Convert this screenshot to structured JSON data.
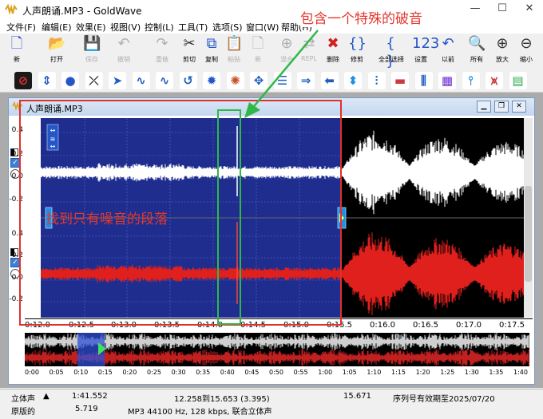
{
  "window": {
    "title": "人声朗诵.MP3 - GoldWave"
  },
  "menu": [
    "文件(F)",
    "编辑(E)",
    "效果(E)",
    "视图(V)",
    "控制(L)",
    "工具(T)",
    "选项(S)",
    "窗口(W)",
    "帮助(H)"
  ],
  "toolbar1": [
    {
      "label": "新",
      "icon": "new-file-icon",
      "glyph": "🗋",
      "disabled": false
    },
    {
      "label": "打开",
      "icon": "open-folder-icon",
      "glyph": "📂",
      "disabled": false
    },
    {
      "label": "保存",
      "icon": "save-icon",
      "glyph": "💾",
      "disabled": true
    },
    {
      "label": "撤销",
      "icon": "undo-icon",
      "glyph": "↶",
      "disabled": true
    },
    {
      "label": "重做",
      "icon": "redo-icon",
      "glyph": "↷",
      "disabled": true
    },
    {
      "label": "剪切",
      "icon": "cut-icon",
      "glyph": "✂",
      "disabled": false
    },
    {
      "label": "复制",
      "icon": "copy-icon",
      "glyph": "⧉",
      "disabled": false
    },
    {
      "label": "粘贴",
      "icon": "paste-icon",
      "glyph": "📋",
      "disabled": true
    },
    {
      "label": "新",
      "icon": "paste-new-icon",
      "glyph": "🗋",
      "disabled": true
    },
    {
      "label": "混合",
      "icon": "mix-icon",
      "glyph": "⊕",
      "disabled": true
    },
    {
      "label": "REPL",
      "icon": "replace-icon",
      "glyph": "⇄",
      "disabled": true
    },
    {
      "label": "删除",
      "icon": "delete-icon",
      "glyph": "✖",
      "disabled": false
    },
    {
      "label": "修剪",
      "icon": "trim-icon",
      "glyph": "{}",
      "disabled": false
    },
    {
      "label": "全部选择",
      "icon": "select-all-icon",
      "glyph": "{ }",
      "disabled": false
    },
    {
      "label": "设置",
      "icon": "set-icon",
      "glyph": "123",
      "disabled": false
    },
    {
      "label": "以前",
      "icon": "previous-icon",
      "glyph": "↶",
      "disabled": false
    },
    {
      "label": "所有",
      "icon": "zoom-all-icon",
      "glyph": "🔍",
      "disabled": false
    },
    {
      "label": "放大",
      "icon": "zoom-in-icon",
      "glyph": "⊕",
      "disabled": false
    },
    {
      "label": "缩小",
      "icon": "zoom-out-icon",
      "glyph": "⊖",
      "disabled": false
    }
  ],
  "toolbar2": [
    {
      "icon": "stop-record-icon",
      "glyph": "⊘",
      "bg": "#1a1a1a",
      "fg": "#e03030"
    },
    {
      "icon": "vertical-arrows-icon",
      "glyph": "⇕",
      "bg": "#ffffff",
      "fg": "#1f5fbf"
    },
    {
      "icon": "blue-ball-icon",
      "glyph": "●",
      "bg": "#ffffff",
      "fg": "#2456c8"
    },
    {
      "icon": "cross-arrows-icon",
      "glyph": "⤫",
      "bg": "#ffffff",
      "fg": "#333333"
    },
    {
      "icon": "forward-arrow-icon",
      "glyph": "➤",
      "bg": "#ffffff",
      "fg": "#1f5fbf"
    },
    {
      "icon": "wave-icon",
      "glyph": "∿",
      "bg": "#ffffff",
      "fg": "#1f5fbf"
    },
    {
      "icon": "wave-icon-2",
      "glyph": "∿",
      "bg": "#ffffff",
      "fg": "#1f5fbf"
    },
    {
      "icon": "loop-icon",
      "glyph": "↺",
      "bg": "#ffffff",
      "fg": "#1f5fbf"
    },
    {
      "icon": "gear-blue-icon",
      "glyph": "✹",
      "bg": "#ffffff",
      "fg": "#2456c8"
    },
    {
      "icon": "color-gear-icon",
      "glyph": "✺",
      "bg": "#ffffff",
      "fg": "#c8502a"
    },
    {
      "icon": "expand-icon",
      "glyph": "✥",
      "bg": "#ffffff",
      "fg": "#1f5fbf"
    },
    {
      "icon": "list-icon",
      "glyph": "☰",
      "bg": "#ffffff",
      "fg": "#1f5fbf"
    },
    {
      "icon": "double-arrow-icon",
      "glyph": "⇒",
      "bg": "#ffffff",
      "fg": "#1f5fbf"
    },
    {
      "icon": "left-arrow-icon",
      "glyph": "⬅",
      "bg": "#ffffff",
      "fg": "#1f5fbf"
    },
    {
      "icon": "invert-icon",
      "glyph": "⬍",
      "bg": "#ffffff",
      "fg": "#1f8fe0"
    },
    {
      "icon": "equalizer-icon",
      "glyph": "⫶",
      "bg": "#ffffff",
      "fg": "#1f5fbf"
    },
    {
      "icon": "color-bar-icon",
      "glyph": "▬",
      "bg": "#ffffff",
      "fg": "#d03a3a"
    },
    {
      "icon": "filter-icon",
      "glyph": "⫼",
      "bg": "#ffffff",
      "fg": "#1f5fbf"
    },
    {
      "icon": "spectrum-icon",
      "glyph": "▦",
      "bg": "#ffffff",
      "fg": "#6a2ad0"
    },
    {
      "icon": "split-icon",
      "glyph": "⫯",
      "bg": "#ffffff",
      "fg": "#1f8fe0"
    },
    {
      "icon": "noise-icon",
      "glyph": "⩙",
      "bg": "#ffffff",
      "fg": "#d03a3a"
    },
    {
      "icon": "rainbow-icon",
      "glyph": "▤",
      "bg": "#ffffff",
      "fg": "#2aa84a"
    }
  ],
  "document": {
    "title": "人声朗诵.MP3"
  },
  "wave": {
    "y_ticks": [
      "0.4",
      "0.2",
      "0.0",
      "-0.2",
      "0.4",
      "0.2",
      "0.0",
      "-0.2"
    ],
    "time_labels": [
      "0:12.0",
      "0:12.5",
      "0:13.0",
      "0:13.5",
      "0:14.0",
      "0:14.5",
      "0:15.0",
      "0:15.5",
      "0:16.0",
      "0:16.5",
      "0:17.0",
      "0:17.5"
    ],
    "overview_labels": [
      "0:00",
      "0:05",
      "0:10",
      "0:15",
      "0:20",
      "0:25",
      "0:30",
      "0:35",
      "0:40",
      "0:45",
      "0:50",
      "0:55",
      "1:00",
      "1:05",
      "1:10",
      "1:15",
      "1:20",
      "1:25",
      "1:30",
      "1:35",
      "1:40"
    ]
  },
  "status": {
    "row1": {
      "channel": "立体声",
      "length": "1:41.552",
      "selection": "12.258到15.653 (3.395)",
      "position": "15.671",
      "serial": "序列号有效期至2025/07/20"
    },
    "row2": {
      "label": "原版的",
      "value": "5.719",
      "format": "MP3 44100 Hz, 128 kbps, 联合立体声"
    }
  },
  "annotations": {
    "spike": "包含一个特殊的破音",
    "noise": "找到只有噪音的段落"
  },
  "colors": {
    "annotation_red": "#e0312b",
    "annotation_green": "#2fb84a",
    "selection_bg": "#1f2d8f",
    "wave_left": "#ffffff",
    "wave_right": "#e0201c"
  }
}
